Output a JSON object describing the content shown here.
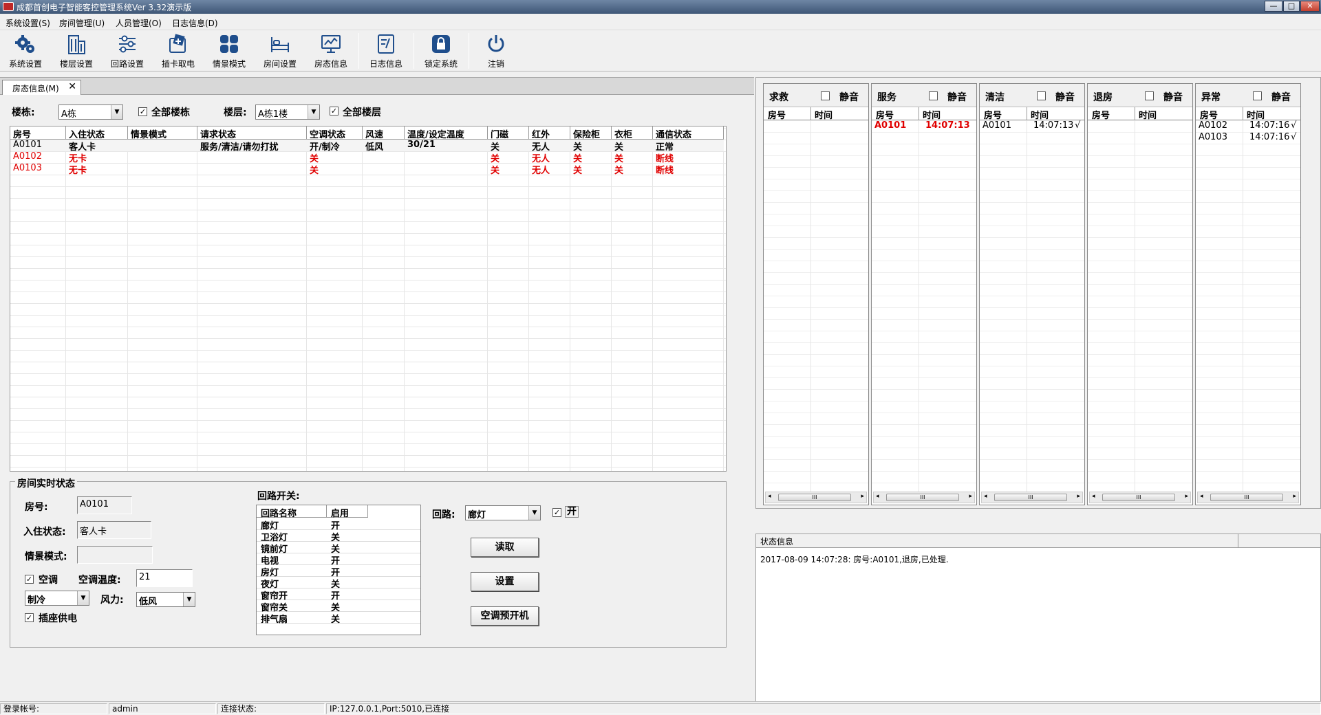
{
  "window": {
    "title": "成都首创电子智能客控管理系统Ver 3.32演示版",
    "buttons": [
      "—",
      "□",
      "✕"
    ]
  },
  "menu": [
    "系统设置(S)",
    "房间管理(U)",
    "人员管理(O)",
    "日志信息(D)"
  ],
  "toolbar": [
    {
      "label": "系统设置",
      "icon": "gears-icon"
    },
    {
      "label": "楼层设置",
      "icon": "building-icon"
    },
    {
      "label": "回路设置",
      "icon": "sliders-icon"
    },
    {
      "label": "插卡取电",
      "icon": "card-icon"
    },
    {
      "label": "情景模式",
      "icon": "grid-icon"
    },
    {
      "label": "房间设置",
      "icon": "bed-icon"
    },
    {
      "label": "房态信息",
      "icon": "monitor-icon"
    },
    {
      "label": "日志信息",
      "icon": "log-icon"
    },
    {
      "label": "锁定系统",
      "icon": "lock-icon"
    },
    {
      "label": "注销",
      "icon": "power-icon"
    }
  ],
  "tab": {
    "label": "房态信息(M)",
    "close": "✕"
  },
  "filters": {
    "building_label": "楼栋:",
    "building_value": "A栋",
    "all_buildings_label": "全部楼栋",
    "all_buildings_checked": "✓",
    "floor_label": "楼层:",
    "floor_value": "A栋1楼",
    "all_floors_label": "全部楼层",
    "all_floors_checked": "✓",
    "arrow": "▼"
  },
  "grid": {
    "columns": [
      "房号",
      "入住状态",
      "情景模式",
      "请求状态",
      "空调状态",
      "风速",
      "温度/设定温度",
      "门磁",
      "红外",
      "保险柜",
      "衣柜",
      "通信状态"
    ],
    "rows": [
      {
        "cells": [
          "A0101",
          "客人卡",
          "",
          "服务/清洁/请勿打扰",
          "开/制冷",
          "低风",
          "30/21",
          "关",
          "无人",
          "关",
          "关",
          "正常"
        ],
        "color": "#000000"
      },
      {
        "cells": [
          "A0102",
          "无卡",
          "",
          "",
          "关",
          "",
          "",
          "关",
          "无人",
          "关",
          "关",
          "断线"
        ],
        "color": "#e00000"
      },
      {
        "cells": [
          "A0103",
          "无卡",
          "",
          "",
          "关",
          "",
          "",
          "关",
          "无人",
          "关",
          "关",
          "断线"
        ],
        "color": "#e00000"
      }
    ]
  },
  "realtime": {
    "title": "房间实时状态",
    "room_label": "房号:",
    "room_value": "A0101",
    "checkin_label": "入住状态:",
    "checkin_value": "客人卡",
    "scene_label": "情景模式:",
    "scene_value": "",
    "ac_label": "空调",
    "ac_checked": "✓",
    "ac_temp_label": "空调温度:",
    "ac_temp_value": "21",
    "mode_value": "制冷",
    "fan_label": "风力:",
    "fan_value": "低风",
    "socket_label": "插座供电",
    "socket_checked": "✓",
    "circuit_switch_label": "回路开关:",
    "circuit_columns": [
      "回路名称",
      "启用"
    ],
    "circuits": [
      {
        "name": "廊灯",
        "state": "开"
      },
      {
        "name": "卫浴灯",
        "state": "关"
      },
      {
        "name": "镜前灯",
        "state": "关"
      },
      {
        "name": "电视",
        "state": "开"
      },
      {
        "name": "房灯",
        "state": "开"
      },
      {
        "name": "夜灯",
        "state": "关"
      },
      {
        "name": "窗帘开",
        "state": "开"
      },
      {
        "name": "窗帘关",
        "state": "关"
      },
      {
        "name": "排气扇",
        "state": "关"
      }
    ],
    "circuit_label": "回路:",
    "circuit_value": "廊灯",
    "circuit_on_label": "开",
    "circuit_on_checked": "✓",
    "btn_read": "读取",
    "btn_set": "设置",
    "btn_ac_preopen": "空调预开机"
  },
  "panels": [
    {
      "title": "求救",
      "mute": "静音",
      "rows": []
    },
    {
      "title": "服务",
      "mute": "静音",
      "rows": [
        {
          "room": "A0101",
          "time": "14:07:13",
          "mark": "",
          "color": "#e00000"
        }
      ]
    },
    {
      "title": "清洁",
      "mute": "静音",
      "rows": [
        {
          "room": "A0101",
          "time": "14:07:13",
          "mark": "√",
          "color": "#000000"
        }
      ]
    },
    {
      "title": "退房",
      "mute": "静音",
      "rows": []
    },
    {
      "title": "异常",
      "mute": "静音",
      "rows": [
        {
          "room": "A0102",
          "time": "14:07:16",
          "mark": "√",
          "color": "#000000"
        },
        {
          "room": "A0103",
          "time": "14:07:16",
          "mark": "√",
          "color": "#000000"
        }
      ]
    }
  ],
  "panel_columns": [
    "房号",
    "时间"
  ],
  "scroll": {
    "left": "◂",
    "right": "▸",
    "thumb": "III"
  },
  "status_info": {
    "title": "状态信息",
    "lines": [
      "2017-08-09 14:07:28: 房号:A0101,退房,已处理."
    ]
  },
  "statusbar": {
    "login_label": "登录帐号:",
    "login_value": "admin",
    "conn_label": "连接状态:",
    "conn_value": "IP:127.0.0.1,Port:5010,已连接"
  }
}
